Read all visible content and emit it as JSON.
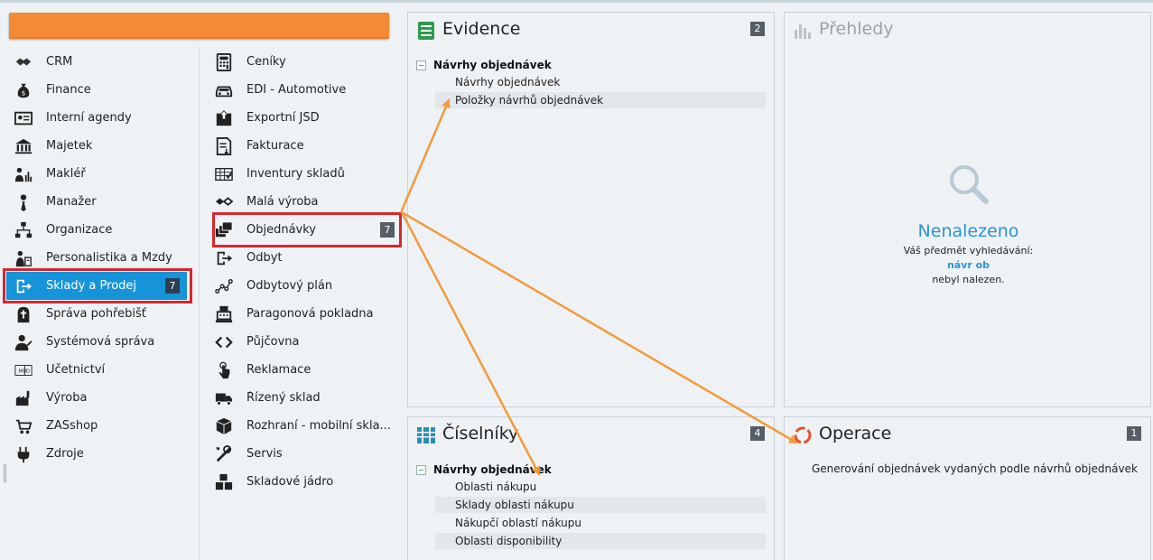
{
  "search": {
    "color": "#f58a35"
  },
  "modules": [
    {
      "label": "CRM",
      "icon": "handshake-icon"
    },
    {
      "label": "Finance",
      "icon": "money-bag-icon"
    },
    {
      "label": "Interní agendy",
      "icon": "id-card-icon"
    },
    {
      "label": "Majetek",
      "icon": "bank-building-icon"
    },
    {
      "label": "Makléř",
      "icon": "broker-chart-icon"
    },
    {
      "label": "Manažer",
      "icon": "manager-tie-icon"
    },
    {
      "label": "Organizace",
      "icon": "org-chart-icon"
    },
    {
      "label": "Personalistika a Mzdy",
      "icon": "personnel-icon"
    },
    {
      "label": "Sklady a Prodej",
      "icon": "exit-arrow-icon",
      "badge": "7",
      "selected": true
    },
    {
      "label": "Správa pohřebišť",
      "icon": "grave-cross-icon"
    },
    {
      "label": "Systémová správa",
      "icon": "admin-user-icon"
    },
    {
      "label": "Účetnictví",
      "icon": "accounting-md-icon"
    },
    {
      "label": "Výroba",
      "icon": "factory-icon"
    },
    {
      "label": "ZASshop",
      "icon": "shop-cart-icon"
    },
    {
      "label": "Zdroje",
      "icon": "power-plug-icon"
    }
  ],
  "submodules": [
    {
      "label": "Ceníky",
      "icon": "calculator-icon"
    },
    {
      "label": "EDI - Automotive",
      "icon": "car-icon"
    },
    {
      "label": "Exportní JSD",
      "icon": "export-box-icon"
    },
    {
      "label": "Fakturace",
      "icon": "invoice-icon"
    },
    {
      "label": "Inventury skladů",
      "icon": "inventory-checklist-icon"
    },
    {
      "label": "Malá výroba",
      "icon": "small-production-icon"
    },
    {
      "label": "Objednávky",
      "icon": "orders-stack-icon",
      "badge": "7",
      "highlighted": true
    },
    {
      "label": "Odbyt",
      "icon": "exit-arrow-icon"
    },
    {
      "label": "Odbytový plán",
      "icon": "plan-graph-icon"
    },
    {
      "label": "Paragonová pokladna",
      "icon": "cash-register-icon"
    },
    {
      "label": "Půjčovna",
      "icon": "code-brackets-icon"
    },
    {
      "label": "Reklamace",
      "icon": "touch-hand-icon"
    },
    {
      "label": "Řízený sklad",
      "icon": "truck-icon"
    },
    {
      "label": "Rozhraní - mobilní skla...",
      "icon": "package-box-icon"
    },
    {
      "label": "Servis",
      "icon": "tools-icon"
    },
    {
      "label": "Skladové jádro",
      "icon": "boxes-icon"
    }
  ],
  "panels": {
    "evidence": {
      "title": "Evidence",
      "count": "2",
      "group": "Návrhy objednávek",
      "items": [
        "Návrhy objednávek",
        "Položky návrhů objednávek"
      ]
    },
    "prehledy": {
      "title": "Přehledy",
      "not_found_title": "Nenalezeno",
      "not_found_line1": "Váš předmět vyhledávání:",
      "search_term": "návr ob",
      "not_found_line2": "nebyl nalezen."
    },
    "ciselniky": {
      "title": "Číselníky",
      "count": "4",
      "group": "Návrhy objednávek",
      "items": [
        "Oblasti nákupu",
        "Sklady oblasti nákupu",
        "Nákupčí oblastí nákupu",
        "Oblasti disponibility"
      ]
    },
    "operace": {
      "title": "Operace",
      "count": "1",
      "items": [
        "Generování objednávek vydaných podle návrhů objednávek"
      ]
    }
  },
  "colors": {
    "accent": "#1793d9",
    "highlight_border": "#d7262c",
    "arrow": "#f39a3c",
    "link": "#2a93d5"
  }
}
